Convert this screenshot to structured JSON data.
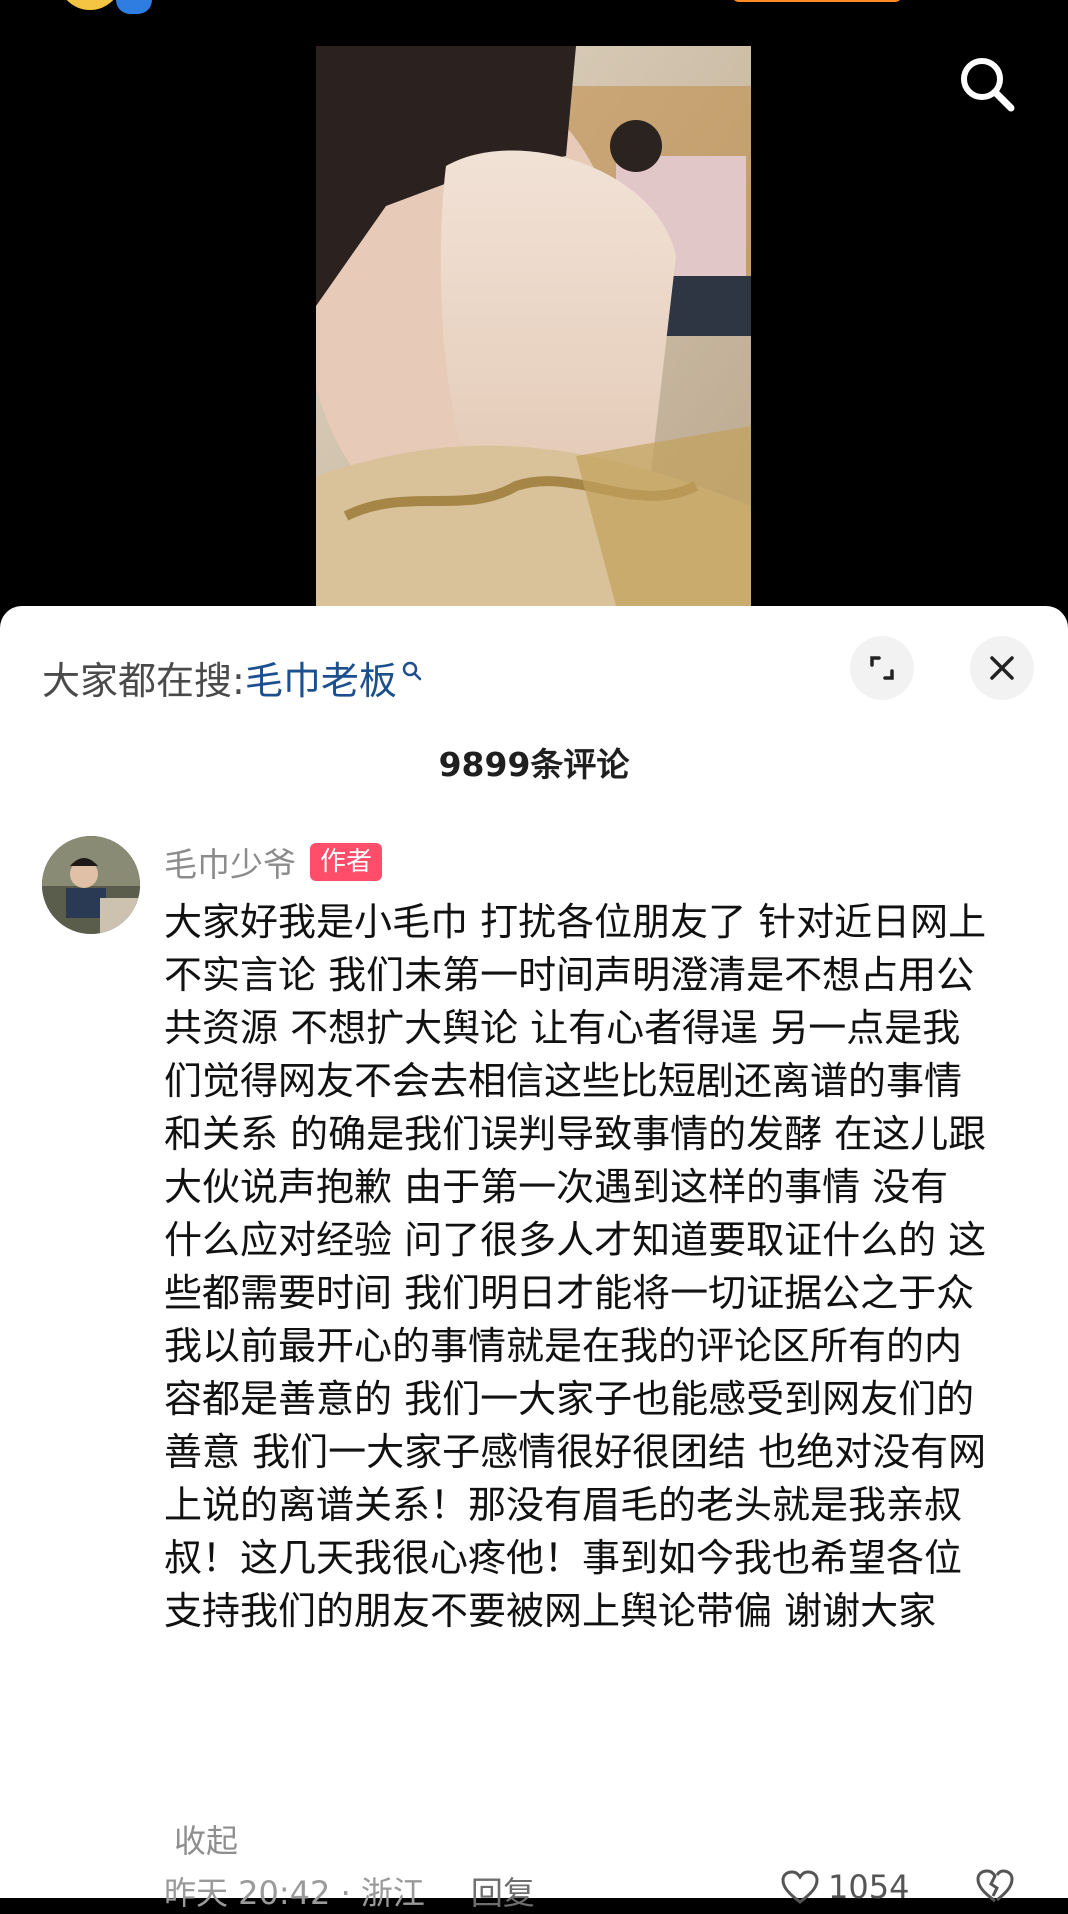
{
  "video": {
    "search_icon": "search-icon"
  },
  "sheet": {
    "trending_prefix": "大家都在搜:",
    "trending_keyword": "毛巾老板",
    "expand_icon": "expand-icon",
    "close_icon": "close-icon",
    "comment_count": "9899条评论"
  },
  "comment": {
    "username": "毛巾少爷",
    "badge": "作者",
    "lines": [
      "大家好我是小毛巾 打扰各位朋友了 针对近日网上",
      "不实言论 我们未第一时间声明澄清是不想占用公",
      "共资源 不想扩大舆论 让有心者得逞 另一点是我",
      "们觉得网友不会去相信这些比短剧还离谱的事情",
      "和关系 的确是我们误判导致事情的发酵 在这儿跟",
      "大伙说声抱歉  由于第一次遇到这样的事情 没有",
      "什么应对经验 问了很多人才知道要取证什么的 这",
      "些都需要时间 我们明日才能将一切证据公之于众",
      "我以前最开心的事情就是在我的评论区所有的内",
      "容都是善意的 我们一大家子也能感受到网友们的",
      "善意 我们一大家子感情很好很团结 也绝对没有网",
      "上说的离谱关系！那没有眉毛的老头就是我亲叔",
      "叔！这几天我很心疼他！事到如今我也希望各位",
      "支持我们的朋友不要被网上舆论带偏 谢谢大家"
    ],
    "collapse": "收起",
    "time_location": "昨天 20:42 · 浙江",
    "reply": "回复",
    "likes": "1054"
  },
  "colors": {
    "background": "#000000",
    "sheet": "#ffffff",
    "keyword": "#1c4f8d",
    "badge": "#ff4d6a"
  }
}
